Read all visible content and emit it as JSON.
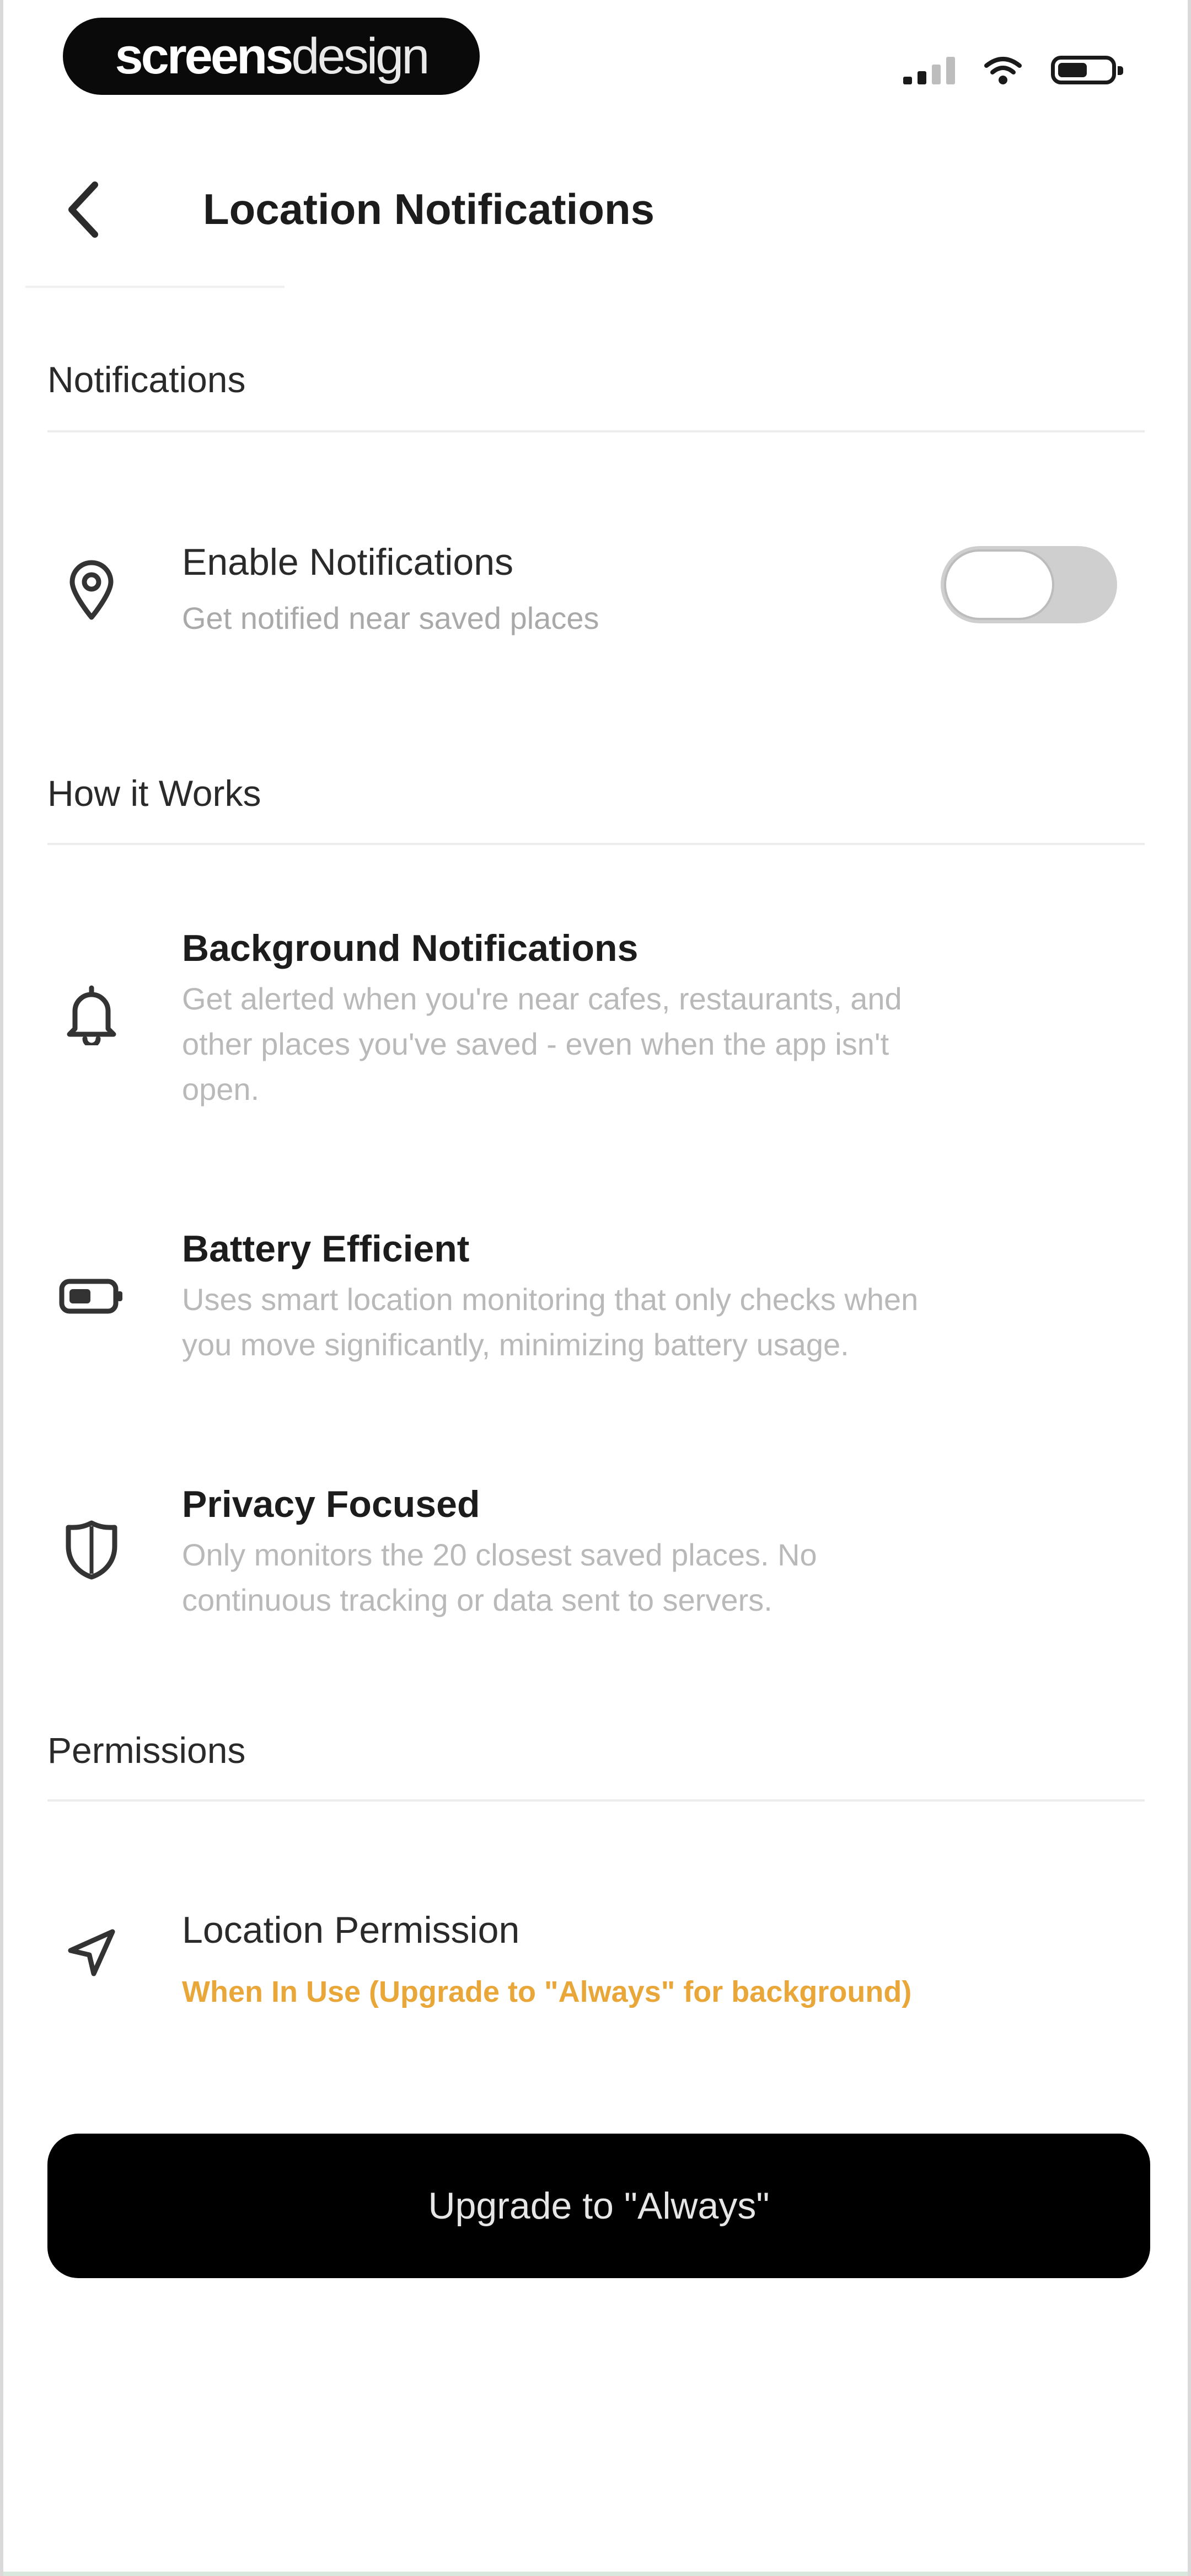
{
  "status_bar": {
    "brand_bold": "screens",
    "brand_thin": "design"
  },
  "nav": {
    "title": "Location Notifications"
  },
  "sections": {
    "notifications": "Notifications",
    "how_it_works": "How it Works",
    "permissions": "Permissions"
  },
  "enable_notifications": {
    "title": "Enable Notifications",
    "subtitle": "Get notified near saved places",
    "enabled": false
  },
  "features": [
    {
      "title": "Background Notifications",
      "line1": "Get alerted when you're near cafes, restaurants, and",
      "line2": "other places you've saved - even when the app isn't",
      "line3": "open."
    },
    {
      "title": "Battery Efficient",
      "line1": "Uses smart location monitoring that only checks when",
      "line2": "you move significantly, minimizing battery usage."
    },
    {
      "title": "Privacy Focused",
      "line1": "Only monitors the 20 closest saved places. No",
      "line2": "continuous tracking or data sent to servers."
    }
  ],
  "location_permission": {
    "title": "Location Permission",
    "status": "When In Use (Upgrade to \"Always\" for background)"
  },
  "upgrade_button": {
    "label": "Upgrade to \"Always\""
  },
  "colors": {
    "warning": "#e9a73a",
    "primary_button": "#000000"
  }
}
